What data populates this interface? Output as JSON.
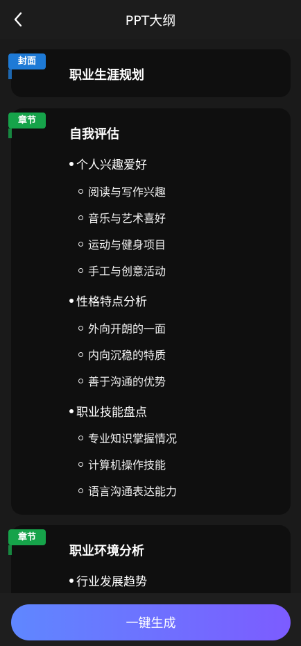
{
  "header": {
    "title": "PPT大纲"
  },
  "cover": {
    "tag": "封面",
    "title": "职业生涯规划"
  },
  "chapters": [
    {
      "tag": "章节",
      "title": "自我评估",
      "sections": [
        {
          "label": "个人兴趣爱好",
          "items": [
            "阅读与写作兴趣",
            "音乐与艺术喜好",
            "运动与健身项目",
            "手工与创意活动"
          ]
        },
        {
          "label": "性格特点分析",
          "items": [
            "外向开朗的一面",
            "内向沉稳的特质",
            "善于沟通的优势"
          ]
        },
        {
          "label": "职业技能盘点",
          "items": [
            "专业知识掌握情况",
            "计算机操作技能",
            "语言沟通表达能力"
          ]
        }
      ]
    },
    {
      "tag": "章节",
      "title": "职业环境分析",
      "sections": [
        {
          "label": "行业发展趋势",
          "items": []
        }
      ]
    }
  ],
  "footer": {
    "button_label": "一键生成"
  }
}
